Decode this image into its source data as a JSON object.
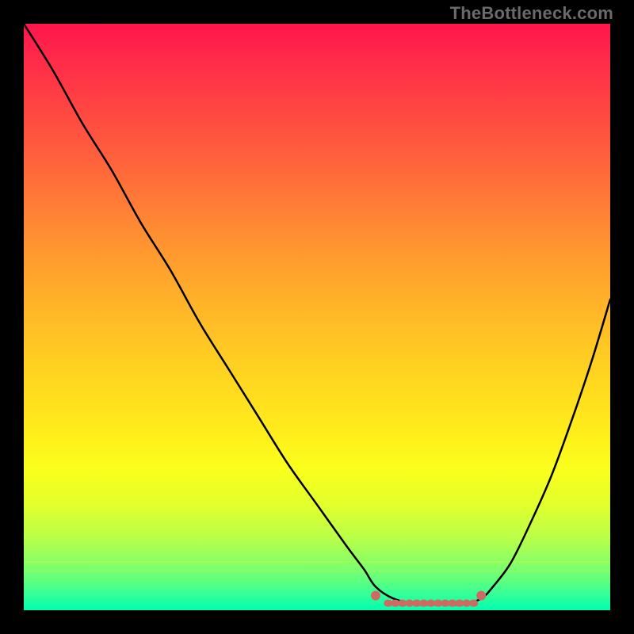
{
  "watermark": "TheBottleneck.com",
  "colors": {
    "frame": "#000000",
    "curve": "#000000",
    "marker": "#cf6a63",
    "gradient_top": "#ff154d",
    "gradient_bottom": "#00ffb0"
  },
  "chart_data": {
    "type": "line",
    "title": "",
    "xlabel": "",
    "ylabel": "",
    "xlim": [
      0,
      100
    ],
    "ylim": [
      0,
      100
    ],
    "grid": false,
    "legend": false,
    "annotations": [],
    "series": [
      {
        "name": "bottleneck-curve",
        "x": [
          0,
          5,
          10,
          15,
          20,
          25,
          30,
          35,
          40,
          45,
          50,
          55,
          58,
          60,
          63,
          67,
          71,
          75,
          78,
          80,
          83,
          86,
          90,
          94,
          97,
          100
        ],
        "y": [
          100,
          92,
          83,
          75,
          66,
          58,
          49,
          41,
          33,
          25,
          18,
          11,
          7,
          4,
          2,
          1,
          1,
          1,
          2,
          4,
          8,
          14,
          23,
          34,
          43,
          53
        ]
      }
    ],
    "markers": [
      {
        "name": "valley-left-cap",
        "x": 60,
        "y": 2.5
      },
      {
        "name": "valley-right-cap",
        "x": 78,
        "y": 2.5
      }
    ],
    "marker_segment": {
      "x0": 62,
      "x1": 77,
      "y": 1.2
    }
  }
}
